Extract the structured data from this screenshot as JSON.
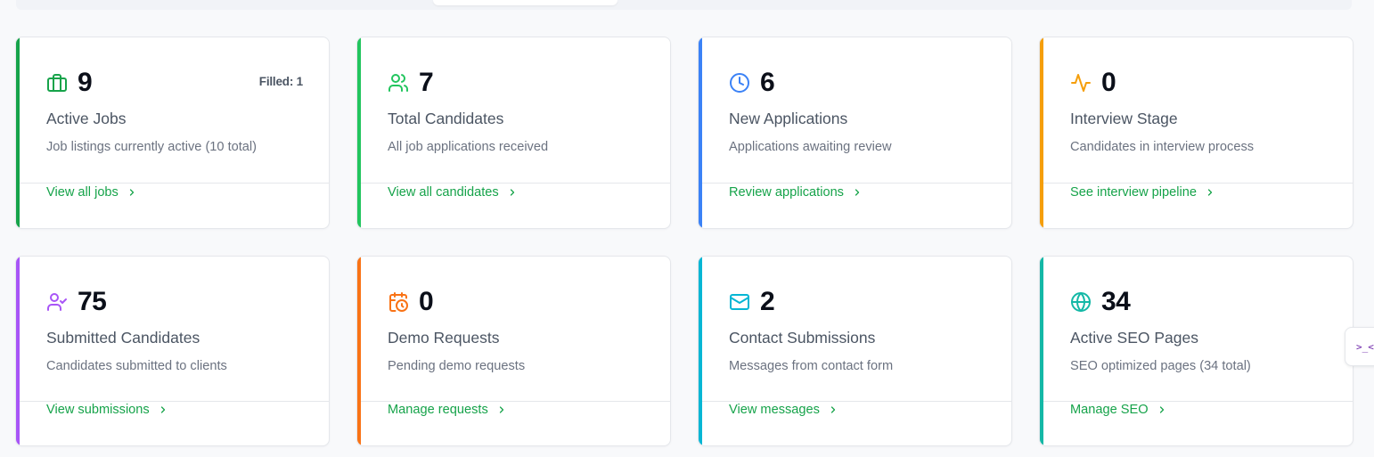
{
  "dashboard": {
    "cards": [
      {
        "value": "9",
        "title": "Active Jobs",
        "description": "Job listings currently active (10 total)",
        "link": "View all jobs",
        "badge": "Filled: 1",
        "icon": "briefcase-icon",
        "accent": "#16a34a",
        "icon_color": "#16a34a"
      },
      {
        "value": "7",
        "title": "Total Candidates",
        "description": "All job applications received",
        "link": "View all candidates",
        "icon": "users-icon",
        "accent": "#22c55e",
        "icon_color": "#22c55e"
      },
      {
        "value": "6",
        "title": "New Applications",
        "description": "Applications awaiting review",
        "link": "Review applications",
        "icon": "clock-icon",
        "accent": "#3b82f6",
        "icon_color": "#3b82f6"
      },
      {
        "value": "0",
        "title": "Interview Stage",
        "description": "Candidates in interview process",
        "link": "See interview pipeline",
        "icon": "activity-icon",
        "accent": "#f59e0b",
        "icon_color": "#f59e0b"
      },
      {
        "value": "75",
        "title": "Submitted Candidates",
        "description": "Candidates submitted to clients",
        "link": "View submissions",
        "icon": "user-check-icon",
        "accent": "#a855f7",
        "icon_color": "#a855f7"
      },
      {
        "value": "0",
        "title": "Demo Requests",
        "description": "Pending demo requests",
        "link": "Manage requests",
        "icon": "calendar-clock-icon",
        "accent": "#f97316",
        "icon_color": "#f97316"
      },
      {
        "value": "2",
        "title": "Contact Submissions",
        "description": "Messages from contact form",
        "link": "View messages",
        "icon": "mail-icon",
        "accent": "#06b6d4",
        "icon_color": "#06b6d4"
      },
      {
        "value": "34",
        "title": "Active SEO Pages",
        "description": "SEO optimized pages (34 total)",
        "link": "Manage SEO",
        "icon": "globe-icon",
        "accent": "#14b8a6",
        "icon_color": "#14b8a6"
      }
    ],
    "link_color": "#16a34a"
  },
  "side_widget": {
    "label": ">_<"
  }
}
